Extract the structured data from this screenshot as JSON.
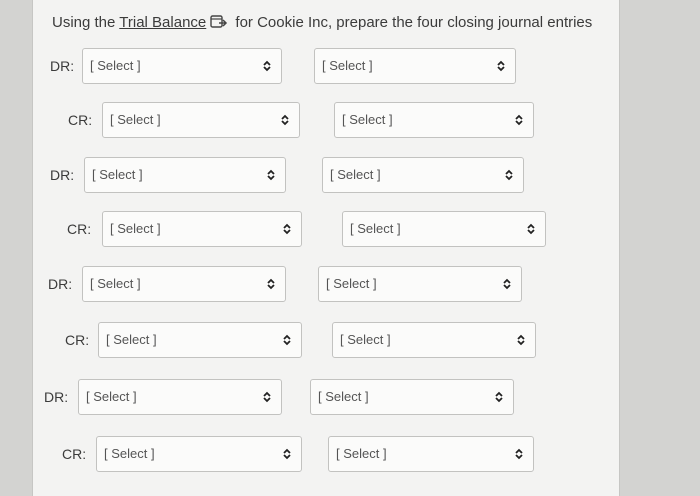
{
  "instruction": {
    "prefix": "Using the ",
    "link": "Trial Balance",
    "suffix": " for Cookie Inc, prepare the four closing journal entries"
  },
  "labels": {
    "debit": "DR:",
    "credit": "CR:"
  },
  "select_placeholder": "[ Select ]",
  "entries": [
    {
      "side": "DR",
      "account": "[ Select ]",
      "amount": "[ Select ]"
    },
    {
      "side": "CR",
      "account": "[ Select ]",
      "amount": "[ Select ]"
    },
    {
      "side": "DR",
      "account": "[ Select ]",
      "amount": "[ Select ]"
    },
    {
      "side": "CR",
      "account": "[ Select ]",
      "amount": "[ Select ]"
    },
    {
      "side": "DR",
      "account": "[ Select ]",
      "amount": "[ Select ]"
    },
    {
      "side": "CR",
      "account": "[ Select ]",
      "amount": "[ Select ]"
    },
    {
      "side": "DR",
      "account": "[ Select ]",
      "amount": "[ Select ]"
    },
    {
      "side": "CR",
      "account": "[ Select ]",
      "amount": "[ Select ]"
    }
  ]
}
